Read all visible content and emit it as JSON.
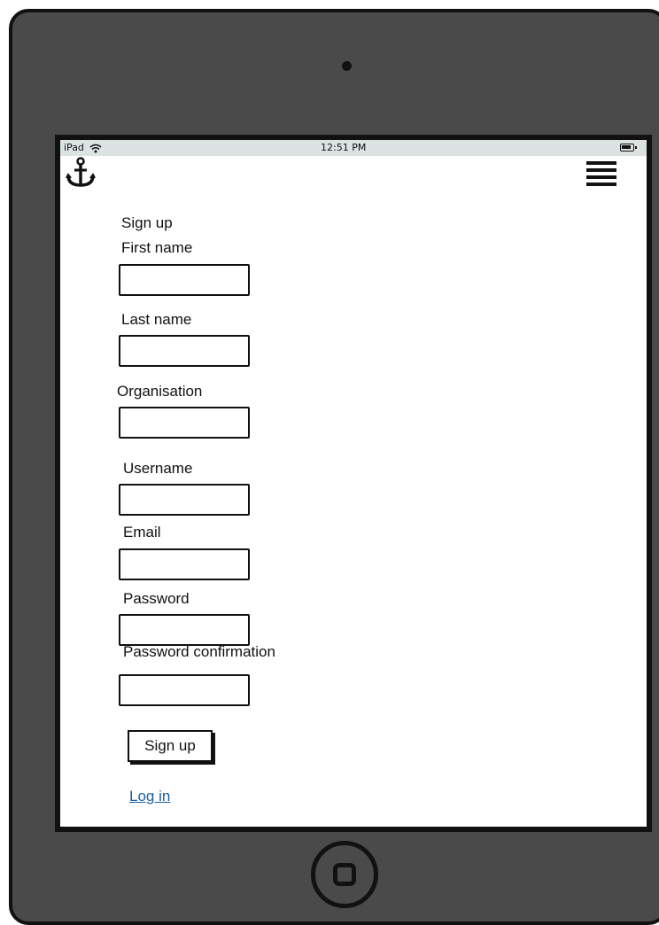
{
  "status_bar": {
    "device": "iPad",
    "time": "12:51 PM",
    "icons": [
      "wifi-icon",
      "battery-icon"
    ]
  },
  "header": {
    "logo_icon": "anchor-icon",
    "menu_icon": "hamburger-menu-icon"
  },
  "form": {
    "title": "Sign up",
    "first_name_label": "First name",
    "first_name_value": "",
    "last_name_label": "Last name",
    "last_name_value": "",
    "organisation_label": "Organisation",
    "organisation_value": "",
    "username_label": "Username",
    "username_value": "",
    "email_label": "Email",
    "email_value": "",
    "password_label": "Password",
    "password_value": "",
    "password_confirmation_label": "Password confirmation",
    "password_confirmation_value": "",
    "submit_label": "Sign up",
    "login_link": "Log in"
  },
  "colors": {
    "frame": "#4a4a4a",
    "status_bar": "#dde3e3",
    "link": "#1a5fa0"
  }
}
